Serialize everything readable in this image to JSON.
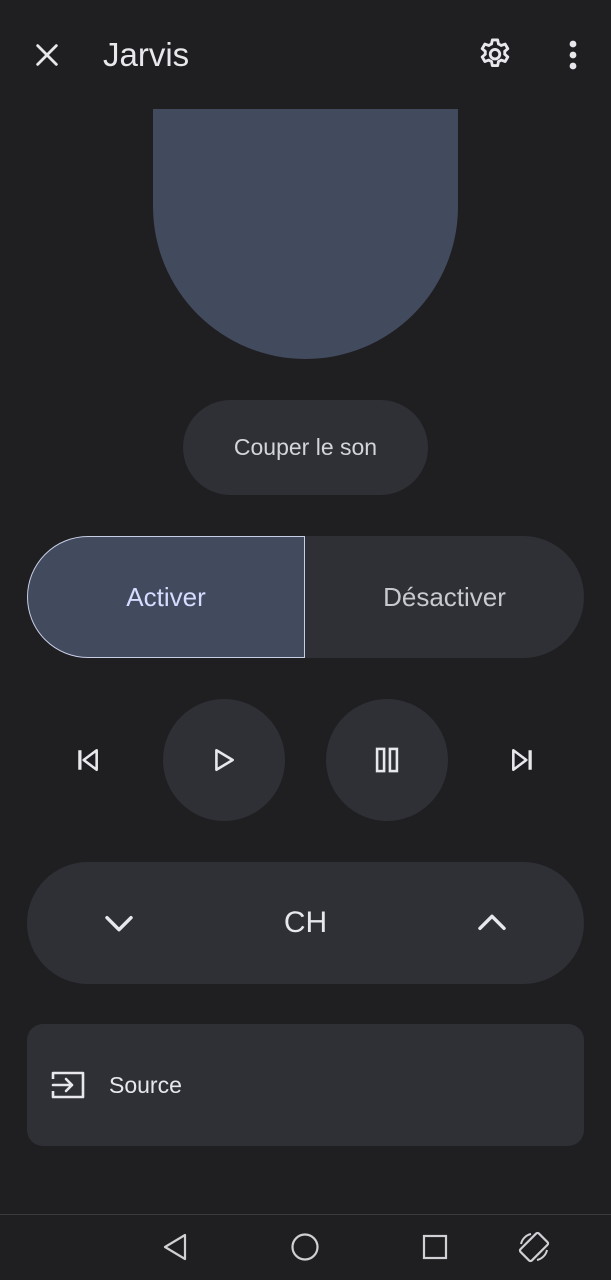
{
  "app_bar": {
    "title": "Jarvis",
    "close_icon": "close-icon",
    "settings_icon": "gear-icon",
    "more_icon": "more-vert-icon"
  },
  "mute": {
    "label": "Couper le son"
  },
  "power_toggle": {
    "on_label": "Activer",
    "off_label": "Désactiver",
    "selected": "on"
  },
  "media": {
    "prev_icon": "skip-previous-icon",
    "play_icon": "play-icon",
    "pause_icon": "pause-icon",
    "next_icon": "skip-next-icon"
  },
  "channel": {
    "label": "CH",
    "down_icon": "chevron-down-icon",
    "up_icon": "chevron-up-icon"
  },
  "source": {
    "label": "Source",
    "icon": "input-icon"
  },
  "system_nav": {
    "back_icon": "back-triangle-icon",
    "home_icon": "home-circle-icon",
    "recents_icon": "recents-square-icon",
    "rotate_icon": "rotate-screen-icon"
  },
  "colors": {
    "background": "#1f1f21",
    "surface": "#2e3036",
    "accent_surface": "#424a5e",
    "accent_text": "#d6dcff"
  }
}
